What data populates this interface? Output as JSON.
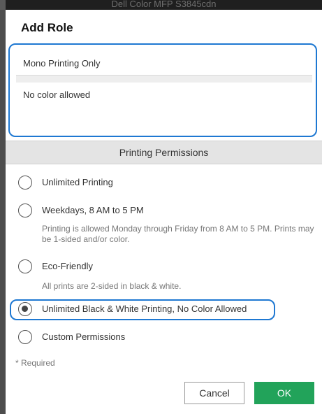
{
  "window": {
    "title": "Dell Color MFP S3845cdn"
  },
  "dialog": {
    "title": "Add Role",
    "fields": {
      "role_name": "Mono Printing Only",
      "role_description": "No color allowed"
    },
    "section_title": "Printing Permissions",
    "options": [
      {
        "label": "Unlimited Printing",
        "description": "",
        "selected": false
      },
      {
        "label": "Weekdays, 8 AM to 5 PM",
        "description": "Printing is allowed Monday through Friday from 8 AM to 5 PM. Prints may be 1-sided and/or color.",
        "selected": false
      },
      {
        "label": "Eco-Friendly",
        "description": "All prints are 2-sided in black & white.",
        "selected": false
      },
      {
        "label": "Unlimited Black & White Printing, No Color Allowed",
        "description": "",
        "selected": true
      },
      {
        "label": "Custom Permissions",
        "description": "",
        "selected": false
      }
    ],
    "required_note": "* Required",
    "buttons": {
      "cancel": "Cancel",
      "ok": "OK"
    }
  },
  "colors": {
    "accent_outline": "#1e78d2",
    "ok_button": "#22a35a",
    "section_header_bg": "#e4e4e4",
    "backdrop": "#4d4d4d"
  }
}
